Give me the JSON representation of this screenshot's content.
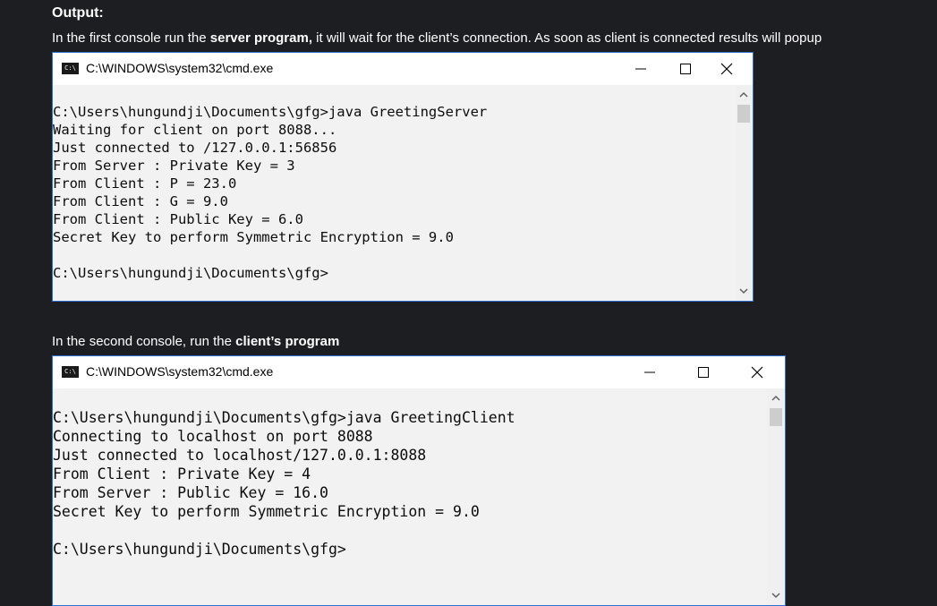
{
  "heading": "Output:",
  "para1": {
    "pre": "In the first console run the ",
    "bold": "server program,",
    "post": " it will wait for the client’s connection. As soon as client is connected results will popup"
  },
  "para2": {
    "pre": "In the second console, run the ",
    "bold": "client’s program"
  },
  "window1": {
    "title": "C:\\WINDOWS\\system32\\cmd.exe",
    "icon_text": "C:\\",
    "lines": [
      "C:\\Users\\hungundji\\Documents\\gfg>java GreetingServer",
      "Waiting for client on port 8088...",
      "Just connected to /127.0.0.1:56856",
      "From Server : Private Key = 3",
      "From Client : P = 23.0",
      "From Client : G = 9.0",
      "From Client : Public Key = 6.0",
      "Secret Key to perform Symmetric Encryption = 9.0",
      "",
      "C:\\Users\\hungundji\\Documents\\gfg>"
    ]
  },
  "window2": {
    "title": "C:\\WINDOWS\\system32\\cmd.exe",
    "icon_text": "C:\\",
    "lines": [
      "C:\\Users\\hungundji\\Documents\\gfg>java GreetingClient",
      "Connecting to localhost on port 8088",
      "Just connected to localhost/127.0.0.1:8088",
      "From Client : Private Key = 4",
      "From Server : Public Key = 16.0",
      "Secret Key to perform Symmetric Encryption = 9.0",
      "",
      "C:\\Users\\hungundji\\Documents\\gfg>"
    ]
  },
  "icons": {
    "minimize": "minimize-icon",
    "maximize": "maximize-icon",
    "close": "close-icon",
    "scroll_up": "chevron-up-icon",
    "scroll_down": "chevron-down-icon",
    "cmd": "cmd-icon"
  },
  "colors": {
    "page_bg": "#1c1e22",
    "window_border": "#2f6fd0",
    "console_bg": "#f2f2f2",
    "console_text": "#0c0c0c"
  }
}
